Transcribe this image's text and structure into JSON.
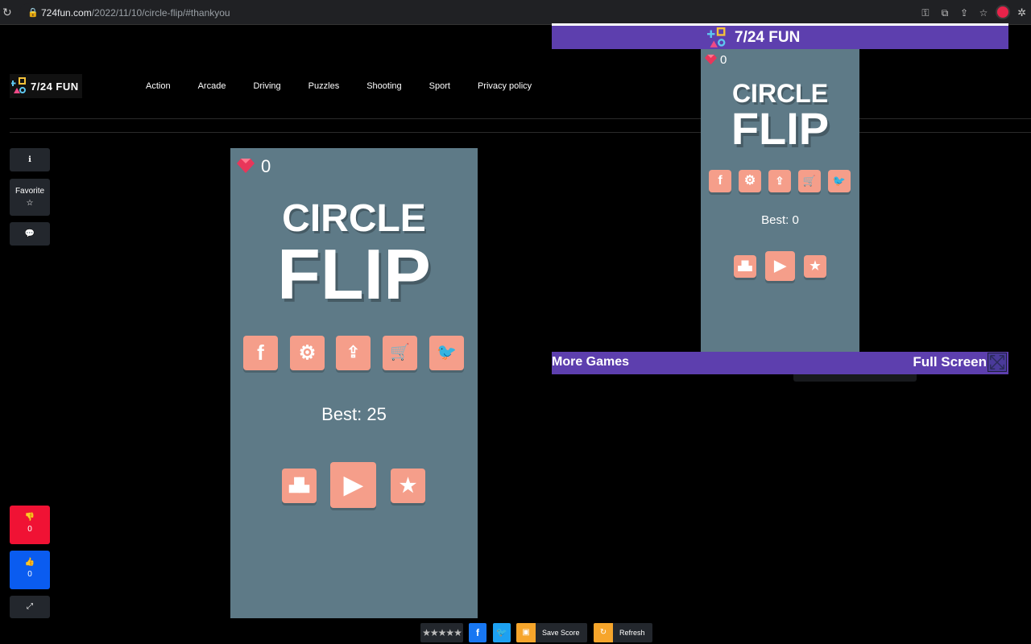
{
  "browser": {
    "url_host": "724fun.com",
    "url_path": "/2022/11/10/circle-flip/#thankyou"
  },
  "site": {
    "logo_text": "7/24 FUN",
    "nav": [
      "Action",
      "Arcade",
      "Driving",
      "Puzzles",
      "Shooting",
      "Sport",
      "Privacy policy"
    ]
  },
  "sidebar": {
    "info_icon": "info-icon",
    "favorite_label": "Favorite",
    "favorite_icon": "☆",
    "chat_icon": "comment-icon",
    "dislike_count": "0",
    "like_count": "0",
    "fullscreen_icon": "expand-icon"
  },
  "game": {
    "gem_count": "0",
    "title_line1": "CIRCLE",
    "title_line2": "FLIP",
    "menu_icons": [
      "facebook-icon",
      "gear-icon",
      "share-icon",
      "cart-icon",
      "twitter-icon"
    ],
    "best_label": "Best: 25",
    "bottom_icons": [
      "leaderboard-icon",
      "play-icon",
      "star-icon"
    ]
  },
  "bottom_bar": {
    "rating_stars": "★★★★★",
    "fb_label": "f",
    "save_label": "Save Score",
    "refresh_label": "Refresh"
  },
  "overlay": {
    "brand": "7/24 FUN",
    "more_games": "More Games",
    "full_screen": "Full Screen",
    "gem_count": "0",
    "title_line1": "CIRCLE",
    "title_line2": "FLIP",
    "best_label": "Best: 0"
  },
  "colors": {
    "game_bg": "#5e7a87",
    "tile": "#f59e8a",
    "overlay_purple": "#5d3fae",
    "dislike": "#f01234",
    "like": "#0a5cf0"
  }
}
